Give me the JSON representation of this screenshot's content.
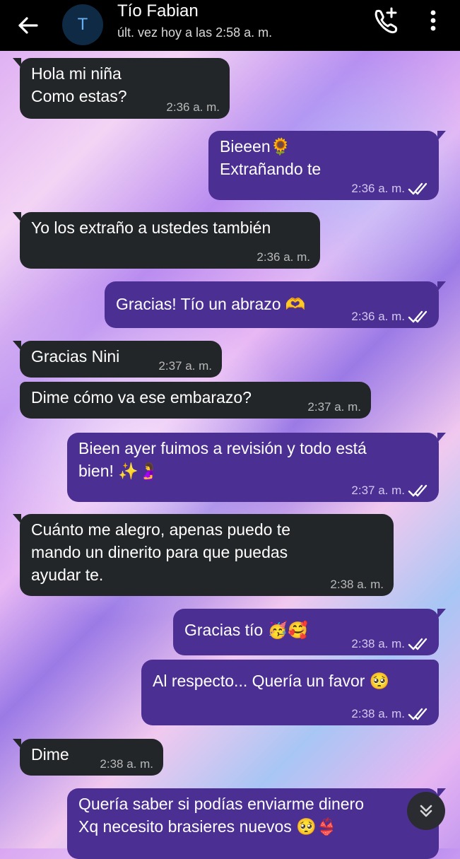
{
  "header": {
    "contact_name": "Tío Fabian",
    "avatar_letter": "T",
    "status": "últ. vez hoy a las 2:58 a. m."
  },
  "messages": [
    {
      "dir": "in",
      "text": "Hola mi niña\nComo estas?",
      "time": "2:36 a. m."
    },
    {
      "dir": "out",
      "text": "Bieeen🌻\nExtrañando te",
      "time": "2:36 a. m."
    },
    {
      "dir": "in",
      "text": "Yo los extraño a ustedes también",
      "time": "2:36 a. m."
    },
    {
      "dir": "out",
      "text": "Gracias! Tío un abrazo 🫶",
      "time": "2:36 a. m."
    },
    {
      "dir": "in",
      "text": "Gracias Nini",
      "time": "2:37 a. m."
    },
    {
      "dir": "in",
      "text": "Dime cómo va ese embarazo?",
      "time": "2:37 a. m."
    },
    {
      "dir": "out",
      "text": "Bieen ayer fuimos a revisión y todo está\nbien! ✨🤰",
      "time": "2:37 a. m."
    },
    {
      "dir": "in",
      "text": "Cuánto me alegro, apenas puedo te\nmando un dinerito para que puedas\nayudar te.",
      "time": "2:38 a. m."
    },
    {
      "dir": "out",
      "text": "Gracias tío 🥳🥰",
      "time": "2:38 a. m."
    },
    {
      "dir": "out",
      "text": "Al respecto... Quería un favor 🥺",
      "time": "2:38 a. m."
    },
    {
      "dir": "in",
      "text": "Dime",
      "time": "2:38 a. m."
    },
    {
      "dir": "out",
      "text": "Quería saber si podías enviarme dinero\nXq necesito brasieres nuevos 🥺👙",
      "time": ""
    }
  ],
  "icons": {
    "back": "arrow-left-icon",
    "call": "add-call-icon",
    "menu": "more-vertical-icon",
    "read": "double-check-icon",
    "scroll": "chevron-double-down-icon"
  },
  "colors": {
    "incoming_bubble": "#222629",
    "outgoing_bubble": "#4c2f93",
    "topbar": "#000000"
  }
}
